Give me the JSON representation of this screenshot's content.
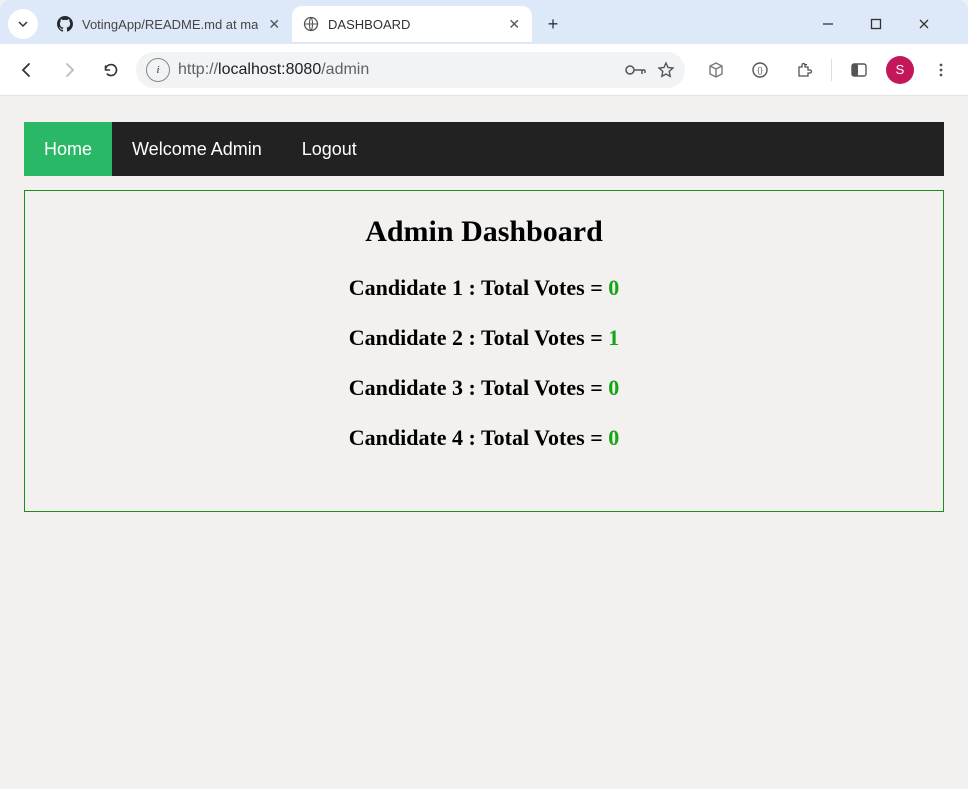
{
  "browser": {
    "tabs": [
      {
        "title": "VotingApp/README.md at ma",
        "active": false,
        "favicon": "github"
      },
      {
        "title": "DASHBOARD",
        "active": true,
        "favicon": "globe"
      }
    ],
    "url_display_prefix": "http://",
    "url_display_host": "localhost:8080",
    "url_display_path": "/admin",
    "avatar_initial": "S"
  },
  "navbar": {
    "items": [
      {
        "label": "Home",
        "active": true
      },
      {
        "label": "Welcome Admin",
        "active": false
      },
      {
        "label": "Logout",
        "active": false
      }
    ]
  },
  "dashboard": {
    "title": "Admin Dashboard",
    "row_prefix": "Candidate ",
    "row_mid": " : Total Votes = ",
    "candidates": [
      {
        "n": "1",
        "votes": "0"
      },
      {
        "n": "2",
        "votes": "1"
      },
      {
        "n": "3",
        "votes": "0"
      },
      {
        "n": "4",
        "votes": "0"
      }
    ]
  }
}
